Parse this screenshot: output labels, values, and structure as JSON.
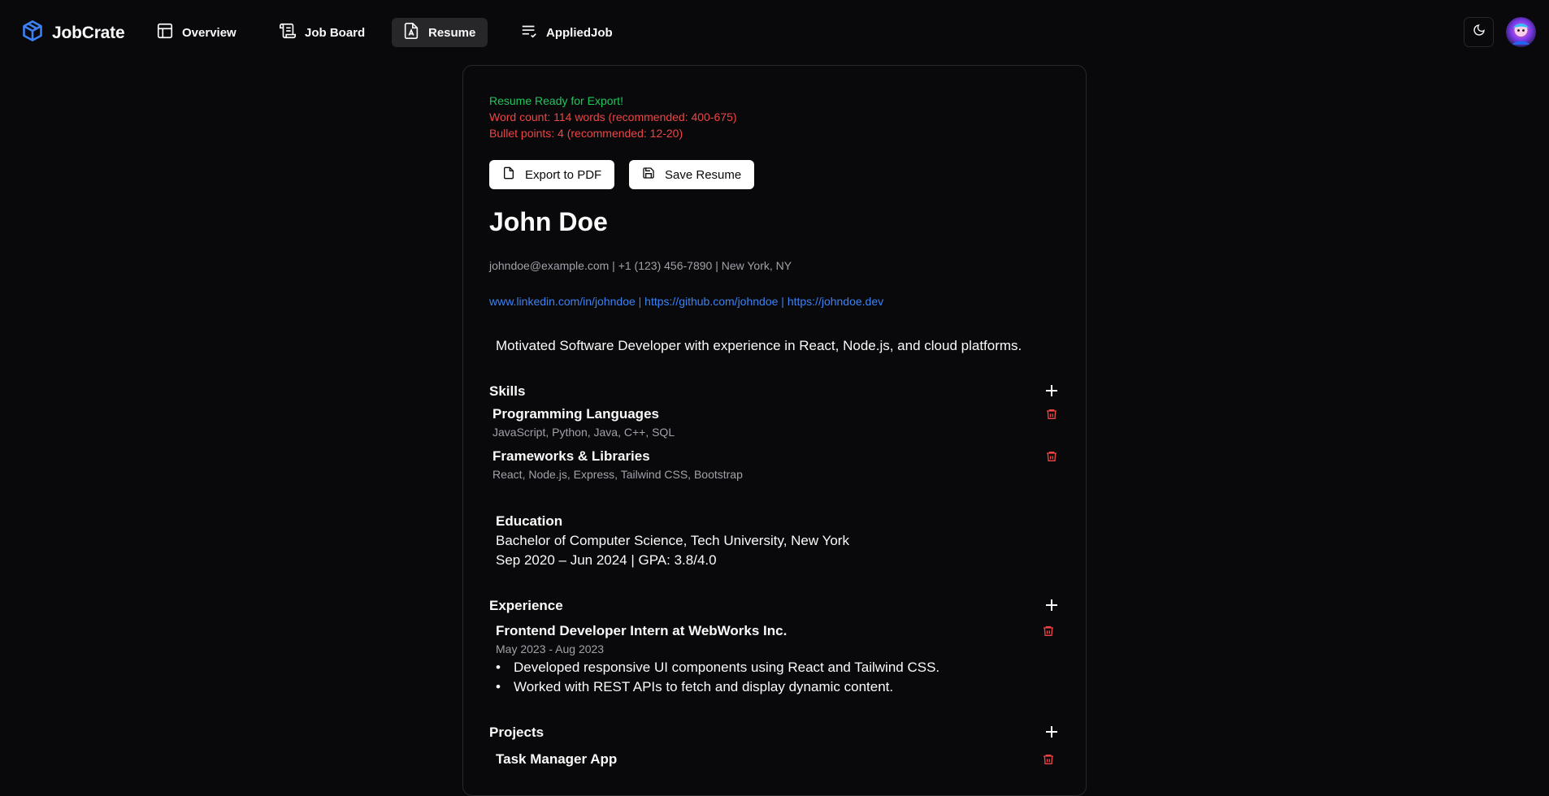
{
  "nav": {
    "brand": "JobCrate",
    "items": [
      {
        "label": "Overview",
        "icon": "layout-icon"
      },
      {
        "label": "Job Board",
        "icon": "scroll-icon"
      },
      {
        "label": "Resume",
        "icon": "resume-file-icon",
        "active": true
      },
      {
        "label": "AppliedJob",
        "icon": "list-check-icon"
      }
    ],
    "theme_icon": "moon-icon"
  },
  "status": {
    "ready": "Resume Ready for Export!",
    "word_count": "Word count: 114 words (recommended: 400-675)",
    "bullets": "Bullet points: 4 (recommended: 12-20)"
  },
  "actions": {
    "export": "Export to PDF",
    "save": "Save Resume"
  },
  "resume": {
    "name": "John Doe",
    "contact": "johndoe@example.com | +1 (123) 456-7890 | New York, NY",
    "links": "www.linkedin.com/in/johndoe | https://github.com/johndoe | https://johndoe.dev",
    "summary": "Motivated Software Developer with experience in React, Node.js, and cloud platforms.",
    "skills": {
      "title": "Skills",
      "items": [
        {
          "name": "Programming Languages",
          "value": "JavaScript, Python, Java, C++, SQL"
        },
        {
          "name": "Frameworks & Libraries",
          "value": "React, Node.js, Express, Tailwind CSS, Bootstrap"
        }
      ]
    },
    "education": {
      "title": "Education",
      "degree": "Bachelor of Computer Science, Tech University, New York",
      "dates": "Sep 2020 – Jun 2024 | GPA: 3.8/4.0"
    },
    "experience": {
      "title": "Experience",
      "items": [
        {
          "role": "Frontend Developer Intern at WebWorks Inc.",
          "dates": "May 2023 - Aug 2023",
          "bullets": [
            "Developed responsive UI components using React and Tailwind CSS.",
            "Worked with REST APIs to fetch and display dynamic content."
          ]
        }
      ]
    },
    "projects": {
      "title": "Projects",
      "items": [
        {
          "name": "Task Manager App"
        }
      ]
    }
  },
  "colors": {
    "background": "#09090b",
    "success": "#22c55e",
    "danger": "#ef4444",
    "link": "#3b82f6",
    "brand_icon": "#3b82f6"
  }
}
